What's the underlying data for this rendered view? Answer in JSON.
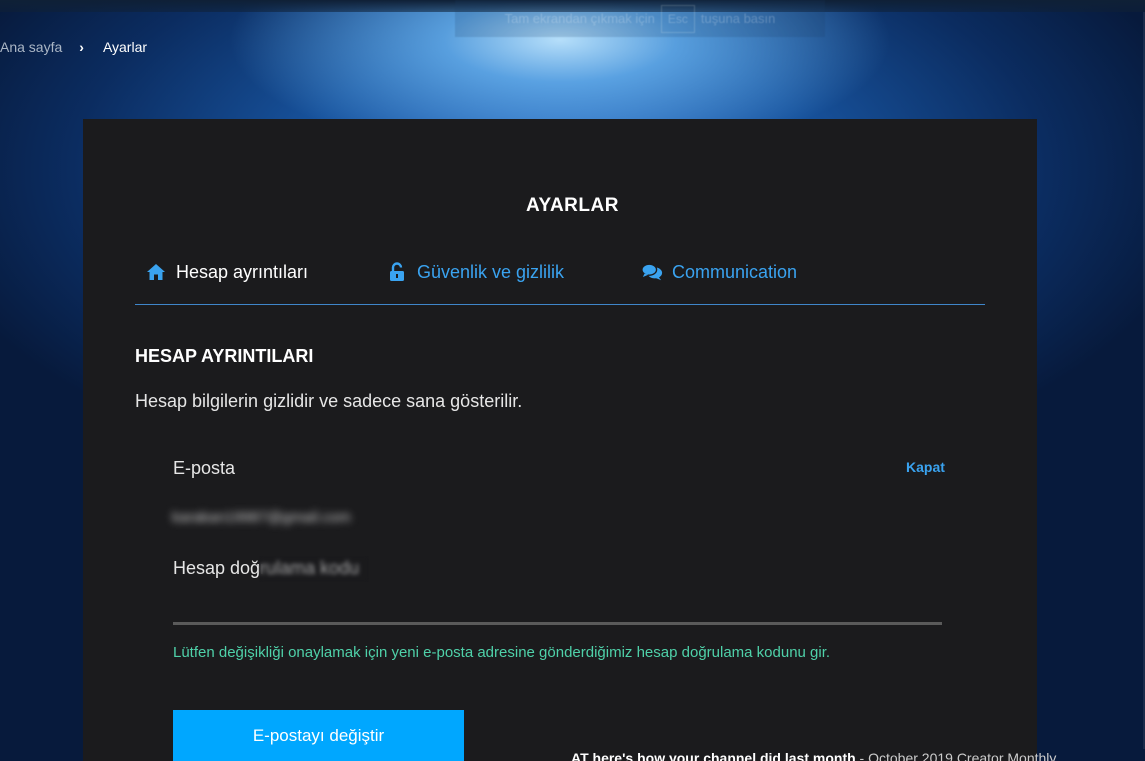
{
  "fullscreen_notice": {
    "prefix": "Tam ekrandan çıkmak için",
    "key": "Esc",
    "suffix": "tuşuna basın"
  },
  "breadcrumb": {
    "home": "Ana sayfa",
    "separator": "›",
    "current": "Ayarlar"
  },
  "panel": {
    "title": "AYARLAR",
    "tabs": [
      {
        "label": "Hesap ayrıntıları",
        "icon": "home-icon",
        "active": true
      },
      {
        "label": "Güvenlik ve gizlilik",
        "icon": "unlock-icon",
        "active": false
      },
      {
        "label": "Communication",
        "icon": "chat-bubbles-icon",
        "active": false
      }
    ]
  },
  "account_section": {
    "heading": "HESAP AYRINTILARI",
    "description": "Hesap bilgilerin gizlidir ve sadece sana gösterilir.",
    "email_label": "E-posta",
    "close_label": "Kapat",
    "email_value": "karakan19987@gmail.com",
    "code_label": "Hesap doğrulama kodu",
    "hint": "Lütfen değişikliği onaylamak için yeni e-posta adresine gönderdiğimiz hesap doğrulama kodunu gir.",
    "change_email_button": "E-postayı değiştir"
  },
  "ticker": {
    "bold": "AT   here's how your channel did last month",
    "rest": " - October 2019 Creator Monthly"
  },
  "colors": {
    "accent": "#00a7ff",
    "link": "#3aa3f0",
    "hint": "#4fd1a9",
    "panel_bg": "#1b1b1d"
  }
}
